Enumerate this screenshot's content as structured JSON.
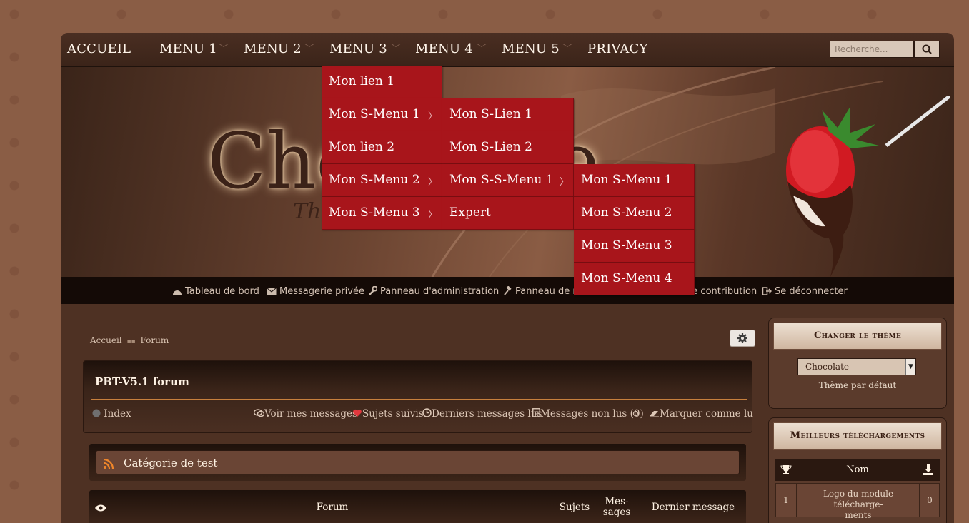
{
  "nav": {
    "items": [
      "ACCUEIL",
      "MENU 1",
      "MENU 2",
      "MENU 3",
      "MENU 4",
      "MENU 5",
      "PRIVACY"
    ],
    "search_placeholder": "Recherche..."
  },
  "banner": {
    "logo": "Chocolate",
    "logo_sub": "The"
  },
  "dropdown": {
    "level1": [
      "Mon lien 1",
      "Mon S-Menu 1",
      "Mon lien 2",
      "Mon S-Menu 2",
      "Mon S-Menu 3"
    ],
    "level2": [
      "Mon S-Lien 1",
      "Mon S-Lien 2",
      "Mon S-S-Menu 1",
      "Expert"
    ],
    "level3": [
      "Mon S-Menu 1",
      "Mon S-Menu 2",
      "Mon S-Menu 3",
      "Mon S-Menu 4"
    ]
  },
  "userbar": {
    "items": [
      "Tableau de bord",
      "Messagerie privée",
      "Panneau d'administration",
      "Panneau de modération",
      "Panneau de contribution",
      "Se déconnecter"
    ]
  },
  "breadcrumb": {
    "home": "Accueil",
    "current": "Forum"
  },
  "forum": {
    "title": "PBT-V5.1 forum",
    "index": "Index",
    "links": [
      "Voir mes messages",
      "Sujets suivis",
      "Derniers messages lus",
      "Messages non lus (0)",
      "Marquer comme lu"
    ]
  },
  "category": {
    "title": "Catégorie de test"
  },
  "table": {
    "col_forum": "Forum",
    "col_topics": "Sujets",
    "col_posts_1": "Mes-",
    "col_posts_2": "sages",
    "col_last": "Dernier message"
  },
  "sidebar": {
    "theme": {
      "title": "Changer le thème",
      "selected": "Chocolate",
      "default_label": "Thème par défaut"
    },
    "downloads": {
      "title": "Meilleurs téléchargements",
      "col_name": "Nom",
      "rows": [
        {
          "rank": "1",
          "name_1": "Logo du module télécharge-",
          "name_2": "ments",
          "count": "0"
        }
      ]
    }
  },
  "colors": {
    "accent": "#a8151b",
    "rule": "#c7803d",
    "page": "#4e3123"
  }
}
